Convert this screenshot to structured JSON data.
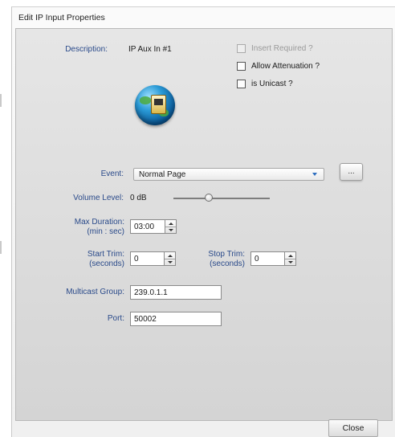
{
  "window": {
    "title": "Edit IP Input Properties"
  },
  "form": {
    "description": {
      "label": "Description:",
      "value": "IP Aux In #1"
    },
    "checkboxes": [
      {
        "label": "Insert Required ?",
        "checked": false,
        "enabled": false
      },
      {
        "label": "Allow Attenuation ?",
        "checked": false,
        "enabled": true
      },
      {
        "label": "is Unicast ?",
        "checked": false,
        "enabled": true
      }
    ],
    "icon": "network-globe-icon",
    "event": {
      "label": "Event:",
      "value": "Normal Page",
      "more_button": "..."
    },
    "volume": {
      "label": "Volume Level:",
      "value": "0 dB",
      "slider_level": 0.37
    },
    "max_duration": {
      "label_line1": "Max Duration:",
      "label_line2": "(min : sec)",
      "value": "03:00"
    },
    "start_trim": {
      "label_line1": "Start Trim:",
      "label_line2": "(seconds)",
      "value": "0"
    },
    "stop_trim": {
      "label_line1": "Stop Trim:",
      "label_line2": "(seconds)",
      "value": "0"
    },
    "multicast_group": {
      "label": "Multicast Group:",
      "value": "239.0.1.1"
    },
    "port": {
      "label": "Port:",
      "value": "50002"
    }
  },
  "footer": {
    "close_label": "Close"
  },
  "colors": {
    "label_blue": "#2a4a8a",
    "arrow_blue": "#2f6fc0"
  }
}
